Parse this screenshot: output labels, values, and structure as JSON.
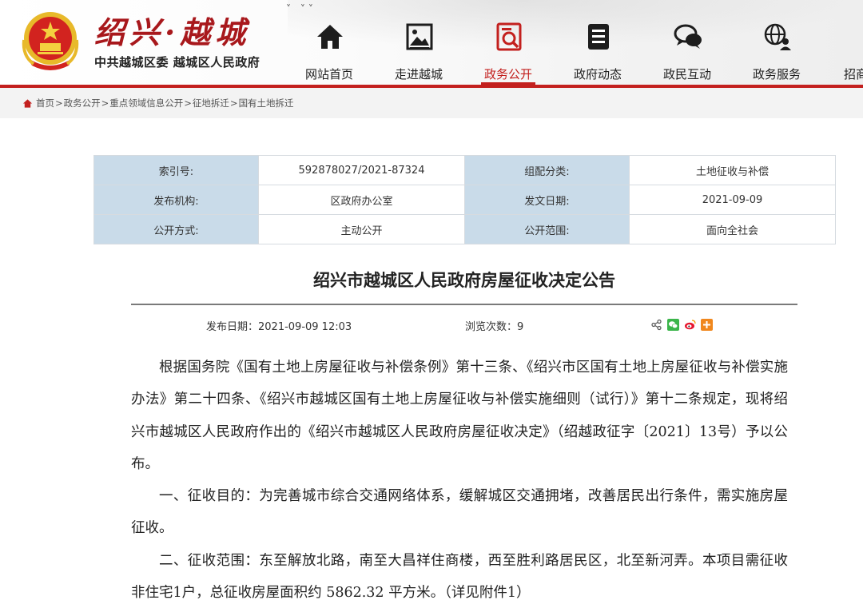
{
  "header": {
    "logo_title": "绍兴·越城",
    "logo_sub": "中共越城区委 越城区人民政府"
  },
  "nav": [
    {
      "label": "网站首页",
      "icon": "home-icon"
    },
    {
      "label": "走进越城",
      "icon": "picture-icon"
    },
    {
      "label": "政务公开",
      "icon": "search-doc-icon",
      "active": true
    },
    {
      "label": "政府动态",
      "icon": "document-icon"
    },
    {
      "label": "政民互动",
      "icon": "chat-icon"
    },
    {
      "label": "政务服务",
      "icon": "globe-user-icon"
    },
    {
      "label": "招商",
      "icon": "partial-icon"
    }
  ],
  "breadcrumb": [
    "首页",
    "政务公开",
    "重点领域信息公开",
    "征地拆迁",
    "国有土地拆迁"
  ],
  "info": {
    "rows": [
      {
        "k1": "索引号:",
        "v1": "592878027/2021-87324",
        "k2": "组配分类:",
        "v2": "土地征收与补偿"
      },
      {
        "k1": "发布机构:",
        "v1": "区政府办公室",
        "k2": "发文日期:",
        "v2": "2021-09-09"
      },
      {
        "k1": "公开方式:",
        "v1": "主动公开",
        "k2": "公开范围:",
        "v2": "面向全社会"
      }
    ]
  },
  "article": {
    "title": "绍兴市越城区人民政府房屋征收决定公告",
    "publish_date": "发布日期：2021-09-09 12:03",
    "views": "浏览次数：9",
    "paragraphs": [
      "根据国务院《国有土地上房屋征收与补偿条例》第十三条、《绍兴市区国有土地上房屋征收与补偿实施办法》第二十四条、《绍兴市越城区国有土地上房屋征收与补偿实施细则（试行）》第十二条规定，现将绍兴市越城区人民政府作出的《绍兴市越城区人民政府房屋征收决定》（绍越政征字〔2021〕13号）予以公布。",
      "一、征收目的：为完善城市综合交通网络体系，缓解城区交通拥堵，改善居民出行条件，需实施房屋征收。",
      "二、征收范围：东至解放北路，南至大昌祥住商楼，西至胜利路居民区，北至新河弄。本项目需征收非住宅1户，总征收房屋面积约 5862.32 平方米。（详见附件1）"
    ]
  },
  "colors": {
    "brand_red": "#c3201e",
    "label_bg": "#c9dbe9"
  }
}
